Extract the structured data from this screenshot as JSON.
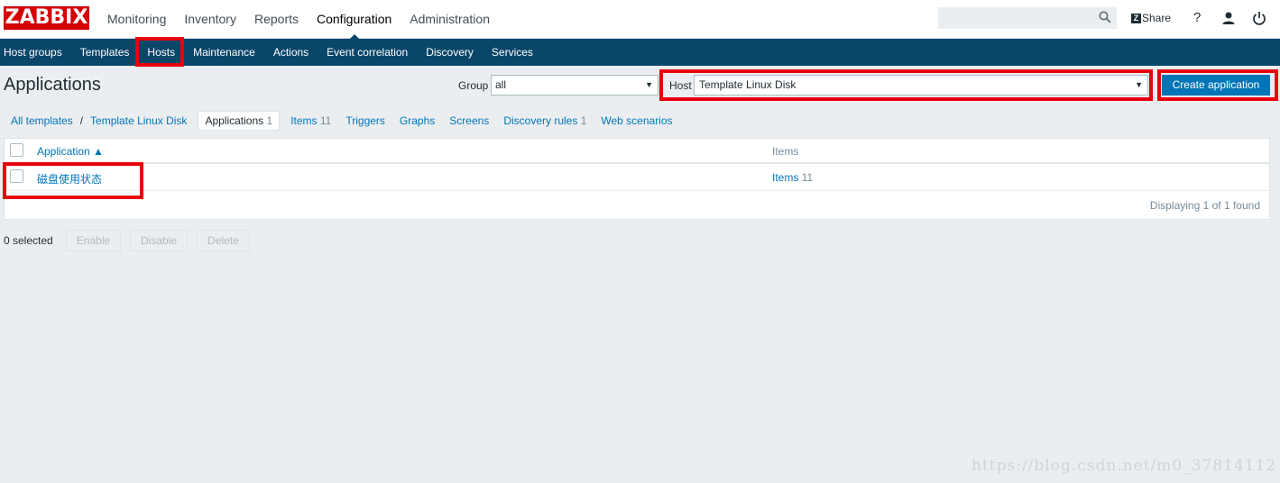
{
  "topbar": {
    "logo": "ZABBIX",
    "menu": [
      "Monitoring",
      "Inventory",
      "Reports",
      "Configuration",
      "Administration"
    ],
    "active_menu": "Configuration",
    "share_label": "Share",
    "help_label": "?"
  },
  "submenu": [
    "Host groups",
    "Templates",
    "Hosts",
    "Maintenance",
    "Actions",
    "Event correlation",
    "Discovery",
    "Services"
  ],
  "page": {
    "title": "Applications",
    "group_label": "Group",
    "group_value": "all",
    "host_label": "Host",
    "host_value": "Template Linux Disk",
    "create_button": "Create application"
  },
  "navtabs": {
    "all_templates": "All templates",
    "separator": "/",
    "template": "Template Linux Disk",
    "applications": "Applications",
    "applications_count": "1",
    "items": "Items",
    "items_count": "11",
    "triggers": "Triggers",
    "graphs": "Graphs",
    "screens": "Screens",
    "discovery_rules": "Discovery rules",
    "discovery_rules_count": "1",
    "web_scenarios": "Web scenarios"
  },
  "table": {
    "col_application": "Application ▲",
    "col_items": "Items",
    "rows": [
      {
        "application": "磁盘使用状态",
        "items_label": "Items",
        "items_count": "11"
      }
    ],
    "paging": "Displaying 1 of 1 found"
  },
  "actions": {
    "selected": "0 selected",
    "enable": "Enable",
    "disable": "Disable",
    "delete": "Delete"
  },
  "watermark": "https://blog.csdn.net/m0_37814112",
  "colors": {
    "brand_red": "#d40000",
    "submenu_bg": "#0a466a",
    "link_blue": "#0275b8",
    "highlight_red": "#e8000b"
  }
}
